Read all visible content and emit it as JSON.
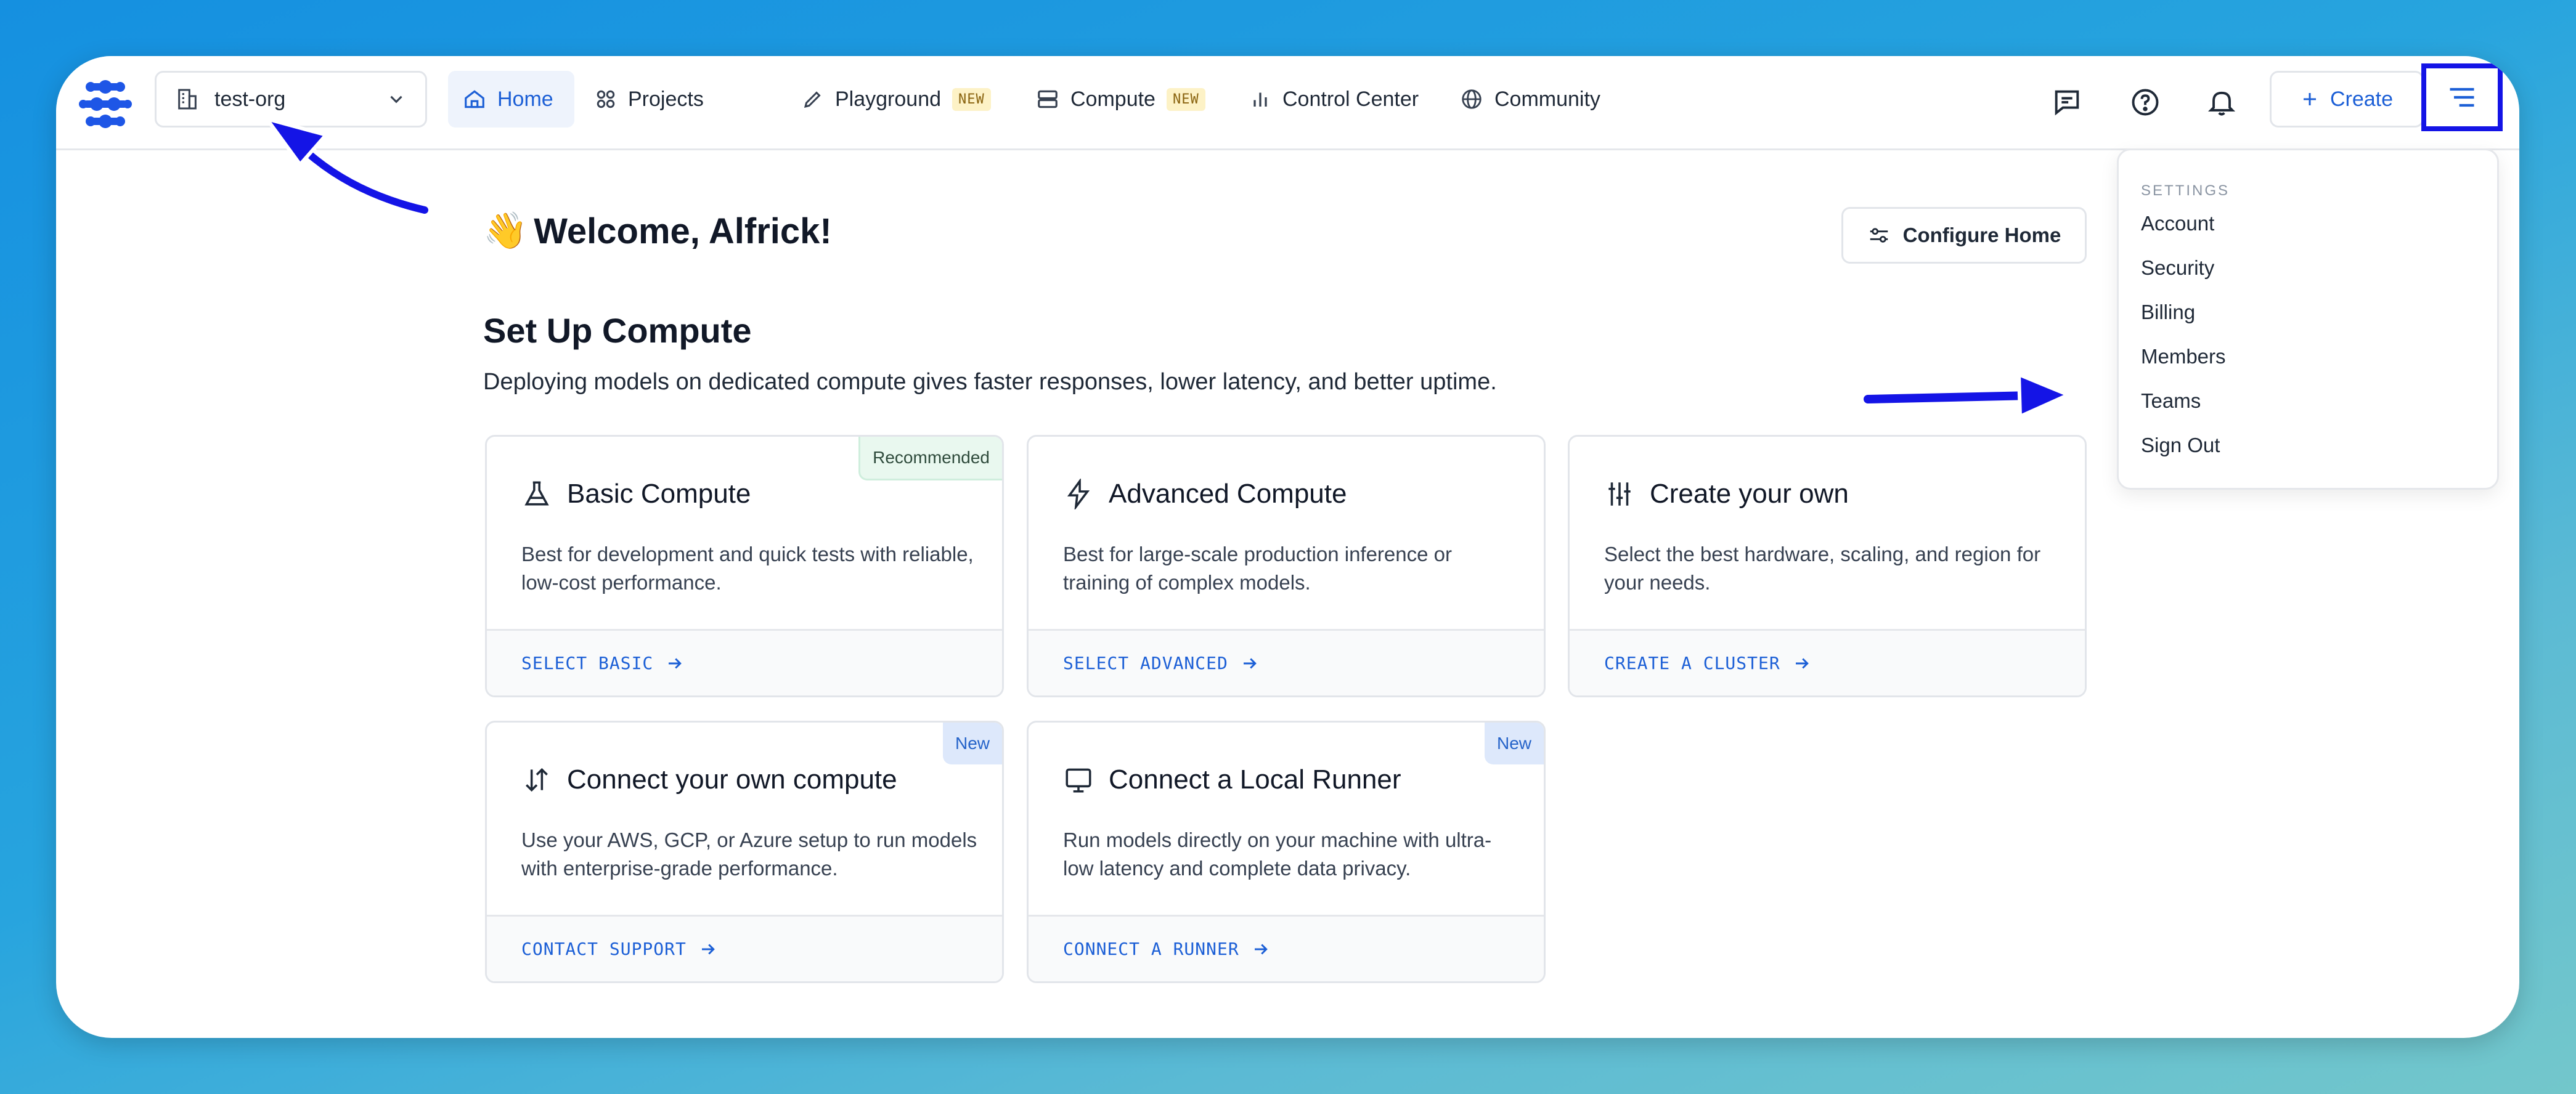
{
  "org": {
    "name": "test-org"
  },
  "nav": {
    "home": "Home",
    "projects": "Projects",
    "playground": "Playground",
    "compute": "Compute",
    "control_center": "Control Center",
    "community": "Community",
    "new_badge": "NEW"
  },
  "header": {
    "create_label": "Create"
  },
  "menu": {
    "section": "SETTINGS",
    "items": [
      "Account",
      "Security",
      "Billing",
      "Members",
      "Teams",
      "Sign Out"
    ]
  },
  "main": {
    "welcome_emoji": "👋",
    "welcome": "Welcome, Alfrick!",
    "configure_home": "Configure Home",
    "section_title": "Set Up Compute",
    "subtitle": "Deploying models on dedicated compute gives faster responses, lower latency, and better uptime."
  },
  "cards": [
    {
      "title": "Basic Compute",
      "desc": "Best for development and quick tests with reliable, low-cost performance.",
      "action": "SELECT BASIC",
      "badge": "Recommended",
      "icon": "flask-icon"
    },
    {
      "title": "Advanced Compute",
      "desc": "Best for large-scale production inference or training of complex models.",
      "action": "SELECT ADVANCED",
      "badge": "",
      "icon": "lightning-icon"
    },
    {
      "title": "Create your own",
      "desc": "Select the best hardware, scaling, and region for your needs.",
      "action": "CREATE A CLUSTER",
      "badge": "",
      "icon": "sliders-icon"
    },
    {
      "title": "Connect your own compute",
      "desc": "Use your AWS, GCP, or Azure setup to run models with enterprise-grade performance.",
      "action": "CONTACT SUPPORT",
      "badge": "New",
      "icon": "up-down-arrows-icon"
    },
    {
      "title": "Connect a Local Runner",
      "desc": "Run models directly on your machine with ultra-low latency and complete data privacy.",
      "action": "CONNECT A RUNNER",
      "badge": "New",
      "icon": "monitor-icon"
    }
  ],
  "colors": {
    "accent": "#1c5fd6",
    "annotation": "#1414e6"
  }
}
